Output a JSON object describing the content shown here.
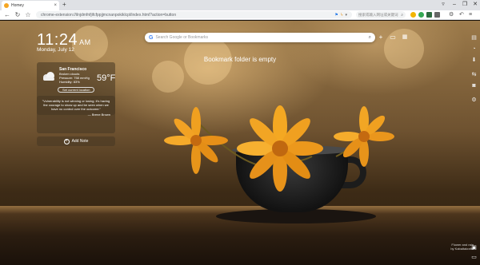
{
  "browser": {
    "tab_title": "Homey",
    "tab_close": "×",
    "new_tab": "+",
    "window_controls": [
      "▿",
      "–",
      "❐",
      "✕"
    ],
    "url": "chrome-extension://ilnjdmfnfjifcfppjjmcnanpokiklcpl/index.html?action=button",
    "side_search_placeholder": "搜索或输入网址或关键词",
    "colors": {
      "tab_favicon": "#f5a623"
    }
  },
  "clock": {
    "time": "11:24",
    "ampm": "AM",
    "date": "Monday, July 12"
  },
  "weather": {
    "city": "San Francisco",
    "condition": "Broken clouds",
    "pressure": "Pressure: 758 mmHg",
    "humidity": "Humidity: 83%",
    "temperature": "59°F",
    "set_location_label": "Set current location"
  },
  "quote": {
    "text": "\"Vulnerability is not winning or losing; it's having the courage to show up and be seen when we have no control over the outcome.\"",
    "author": "— Brene Brown"
  },
  "add_note": {
    "label": "Add Note"
  },
  "search": {
    "placeholder": "Search Google or Bookmarks"
  },
  "bookmarks": {
    "empty_message": "Bookmark folder is empty"
  },
  "credit": {
    "line1": "Flower and rain",
    "line2": "by Kabaltakrafts"
  }
}
